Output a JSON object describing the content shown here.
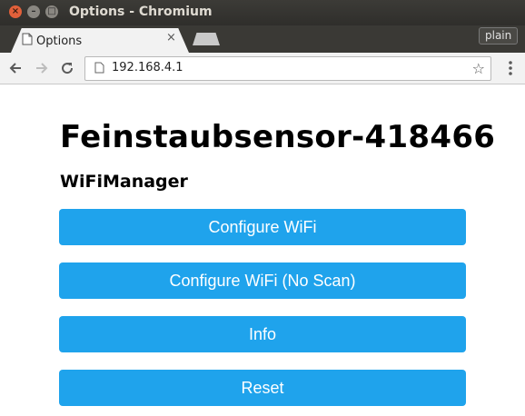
{
  "window": {
    "title": "Options - Chromium",
    "close": "×",
    "minimize": "–",
    "maximize": "□"
  },
  "tab": {
    "title": "Options",
    "close": "×"
  },
  "profile_badge": "plain",
  "toolbar": {
    "url": "192.168.4.1",
    "bookmark_icon": "☆"
  },
  "page": {
    "title": "Feinstaubsensor-418466",
    "subtitle": "WiFiManager",
    "buttons": [
      {
        "label": "Configure WiFi"
      },
      {
        "label": "Configure WiFi (No Scan)"
      },
      {
        "label": "Info"
      },
      {
        "label": "Reset"
      }
    ],
    "button_color": "#1fa3ec"
  }
}
